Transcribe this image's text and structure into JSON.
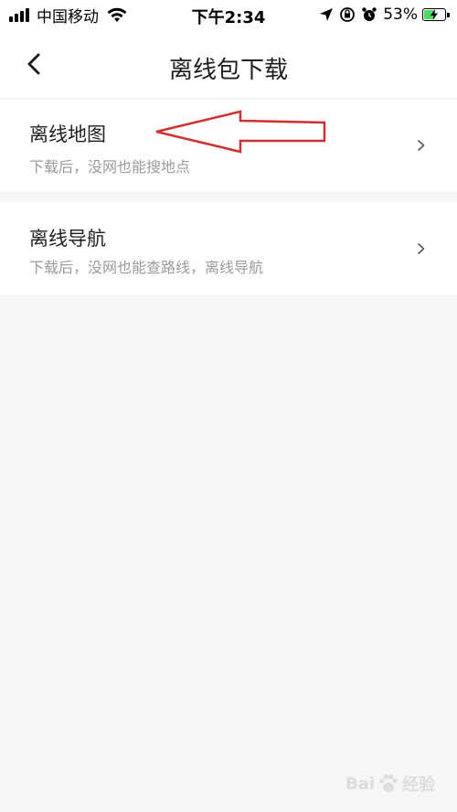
{
  "status_bar": {
    "carrier": "中国移动",
    "time": "下午2:34",
    "battery_percent": "53%",
    "battery_level": 0.53,
    "signal_bars": 4,
    "icons": [
      "signal-icon",
      "wifi-icon",
      "location-arrow-icon",
      "screen-rotation-lock-icon",
      "alarm-icon",
      "battery-charging-icon"
    ]
  },
  "nav": {
    "title": "离线包下载",
    "back_icon": "chevron-left-icon"
  },
  "items": [
    {
      "title": "离线地图",
      "description": "下载后，没网也能搜地点",
      "icon": "chevron-right-icon"
    },
    {
      "title": "离线导航",
      "description": "下载后，没网也能查路线，离线导航",
      "icon": "chevron-right-icon"
    }
  ],
  "annotation": {
    "icon": "red-arrow-icon",
    "color": "#d0302f"
  },
  "watermark": {
    "text_left": "Bai",
    "text_right": "经验",
    "icon": "paw-icon"
  },
  "colors": {
    "background": "#f5f6f8",
    "card": "#ffffff",
    "primary_text": "#1e1e1e",
    "secondary_text": "#9a9a9a",
    "battery_green": "#4cd964"
  }
}
